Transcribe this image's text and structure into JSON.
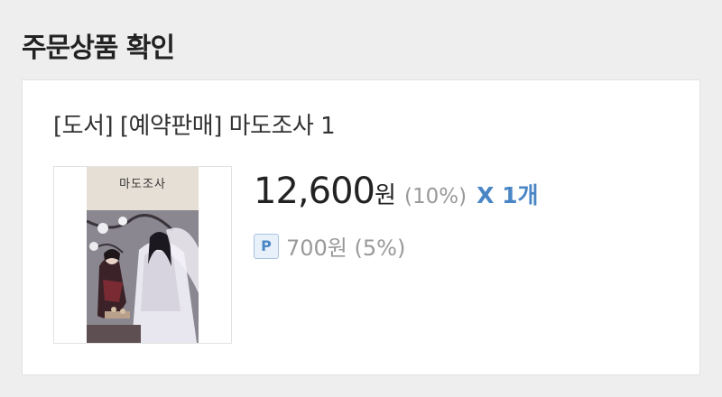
{
  "section": {
    "title": "주문상품 확인"
  },
  "product": {
    "title": "[도서] [예약판매] 마도조사 1",
    "cover_title": "마도조사",
    "price": "12,600",
    "currency": "원",
    "discount": "(10%)",
    "quantity": "X 1개",
    "points_badge": "P",
    "points": "700원 (5%)"
  },
  "colors": {
    "accent": "#4a86c5",
    "muted": "#999999",
    "background": "#eeeeef"
  }
}
